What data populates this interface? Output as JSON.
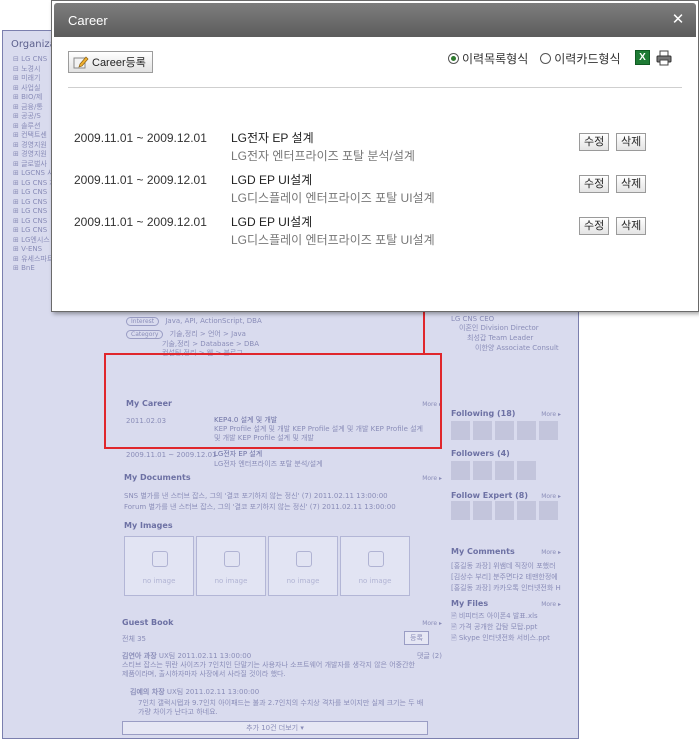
{
  "modal": {
    "title": "Career",
    "register_button": "Career등록",
    "view_options": [
      {
        "label": "이력목록형식",
        "selected": true
      },
      {
        "label": "이력카드형식",
        "selected": false
      }
    ],
    "excel_icon_glyph": "X",
    "edit_label": "수정",
    "delete_label": "삭제",
    "entries": [
      {
        "date": "2009.11.01 ~ 2009.12.01",
        "title": "LG전자 EP 설계",
        "desc": "LG전자 엔터프라이즈 포탈 분석/설계"
      },
      {
        "date": "2009.11.01 ~ 2009.12.01",
        "title": "LGD EP UI설계",
        "desc": "LG디스플레이 엔터프라이즈 포탈 UI설계"
      },
      {
        "date": "2009.11.01 ~ 2009.12.01",
        "title": "LGD EP UI설계",
        "desc": "LG디스플레이 엔터프라이즈 포탈 UI설계"
      }
    ]
  },
  "background": {
    "org_title": "Organizat",
    "tree": [
      "⊟ LG CNS",
      "  ⊟ 노경시",
      "  ⊞ 미래기",
      "  ⊞ 사업실",
      "  ⊞ BIO/제",
      "  ⊞ 금융/통",
      "  ⊞ 공공/S",
      "  ⊞ 솔루션",
      "  ⊞ 컨택트센",
      "  ⊞ 경영지원",
      "  ⊞ 경영지원",
      "  ⊞ 글로벌사",
      "⊞ LGCNS 사",
      "⊞ LG CNS 차",
      "⊞ LG CNS ",
      "⊞ LG CNS ",
      "⊞ LG CNS ",
      "⊞ LG CNS ",
      "⊞ LG CNS ",
      "⊞ LG엔시스",
      "⊞ V-ENS",
      "⊞ 유세스파트",
      "⊞ BnE"
    ],
    "skills_tag": "Interest",
    "skills_text": "Java, API, ActionScript, DBA",
    "category_tag": "Category",
    "category_lines": [
      "기술,정리 > 언어 > Java",
      "기술,정리 > Database > DBA",
      "컨설팅,정리 > 웹 > 블로그"
    ],
    "org_chart": [
      "LG CNS CEO",
      "이혼인 Division Director",
      "최성갑 Team Leader",
      "이한양 Associate Consult"
    ],
    "my_career": {
      "title": "My Career",
      "more": "More ▸",
      "items": [
        {
          "date": "2011.02.03",
          "title": "KEP4.0 설계 및 개발",
          "desc": "KEP Profile 설계 및 개발 KEP Profile 설계 및 개발 KEP Profile 설계 및 개발 KEP Profile 설계 및 개발"
        },
        {
          "date": "2009.11.01 ~ 2009.12.01",
          "title": "LG전자 EP 설계",
          "desc": "LG전자 엔터프라이즈 포탈 분석/설계"
        }
      ]
    },
    "my_documents": {
      "title": "My Documents",
      "more": "More ▸",
      "items": [
        {
          "tag": "SNS",
          "text": "별가를 낸 스터브 잡스, 그의 '결코 포기하지 않는 정신' (7)",
          "date": "2011.02.11 13:00:00"
        },
        {
          "tag": "Forum",
          "text": "별가를 낸 스터브 잡스, 그의 '결코 포기하지 않는 정신' (7)",
          "date": "2011.02.11 13:00:00"
        }
      ]
    },
    "my_images": {
      "title": "My Images",
      "placeholder": "no image"
    },
    "guest_book": {
      "title": "Guest Book",
      "more": "More ▸",
      "count": "전체 35",
      "register": "등록",
      "post_author": "김연아 과장",
      "post_meta": "UX팀 2011.02.11 13:00:00",
      "comment_count": "댓글 (2)",
      "post_text": "스티브 잡스는 뛰란 사이즈가 7인치인 단말기는 사용자나 소프트웨어 개발자를 생각지 않은 어중간한 제품이라며, 출시하자마자 사장에서 사라질 것이라 했다.",
      "reply_author": "김예의 차장",
      "reply_meta": "UX팀 2011.02.11 13:00:00",
      "reply_text": "7인치 갤럭시탭과 9.7인치 아이패드는 불과 2.7인치의 수치상 격차를 보이지만 실제 크기는 두 배 가량 차이가 난다고 하네요.",
      "more_button": "추가 10건 더보기 ▾"
    },
    "following": {
      "title": "Following",
      "count": "(18)",
      "more": "More ▸"
    },
    "followers": {
      "title": "Followers",
      "count": "(4)"
    },
    "follow_expert": {
      "title": "Follow Expert",
      "count": "(8)",
      "more": "More ▸"
    },
    "my_comments": {
      "title": "My Comments",
      "more": "More ▸",
      "items": [
        "[홍길동 과장] 위쌤데 직장이 포했러",
        "[김상수 부리] 분주면다2 테맨한정에",
        "[홍길동 과장] 카카오톡 인터넷전화 H"
      ]
    },
    "my_files": {
      "title": "My Files",
      "more": "More ▸",
      "items": [
        "🗎 비피터즈 아이폰4 발표.xls",
        "🗎 가격 공개한 갑탐 모탑.ppt",
        "🗎 Skype 인터넷전화 서비스.ppt"
      ]
    }
  }
}
